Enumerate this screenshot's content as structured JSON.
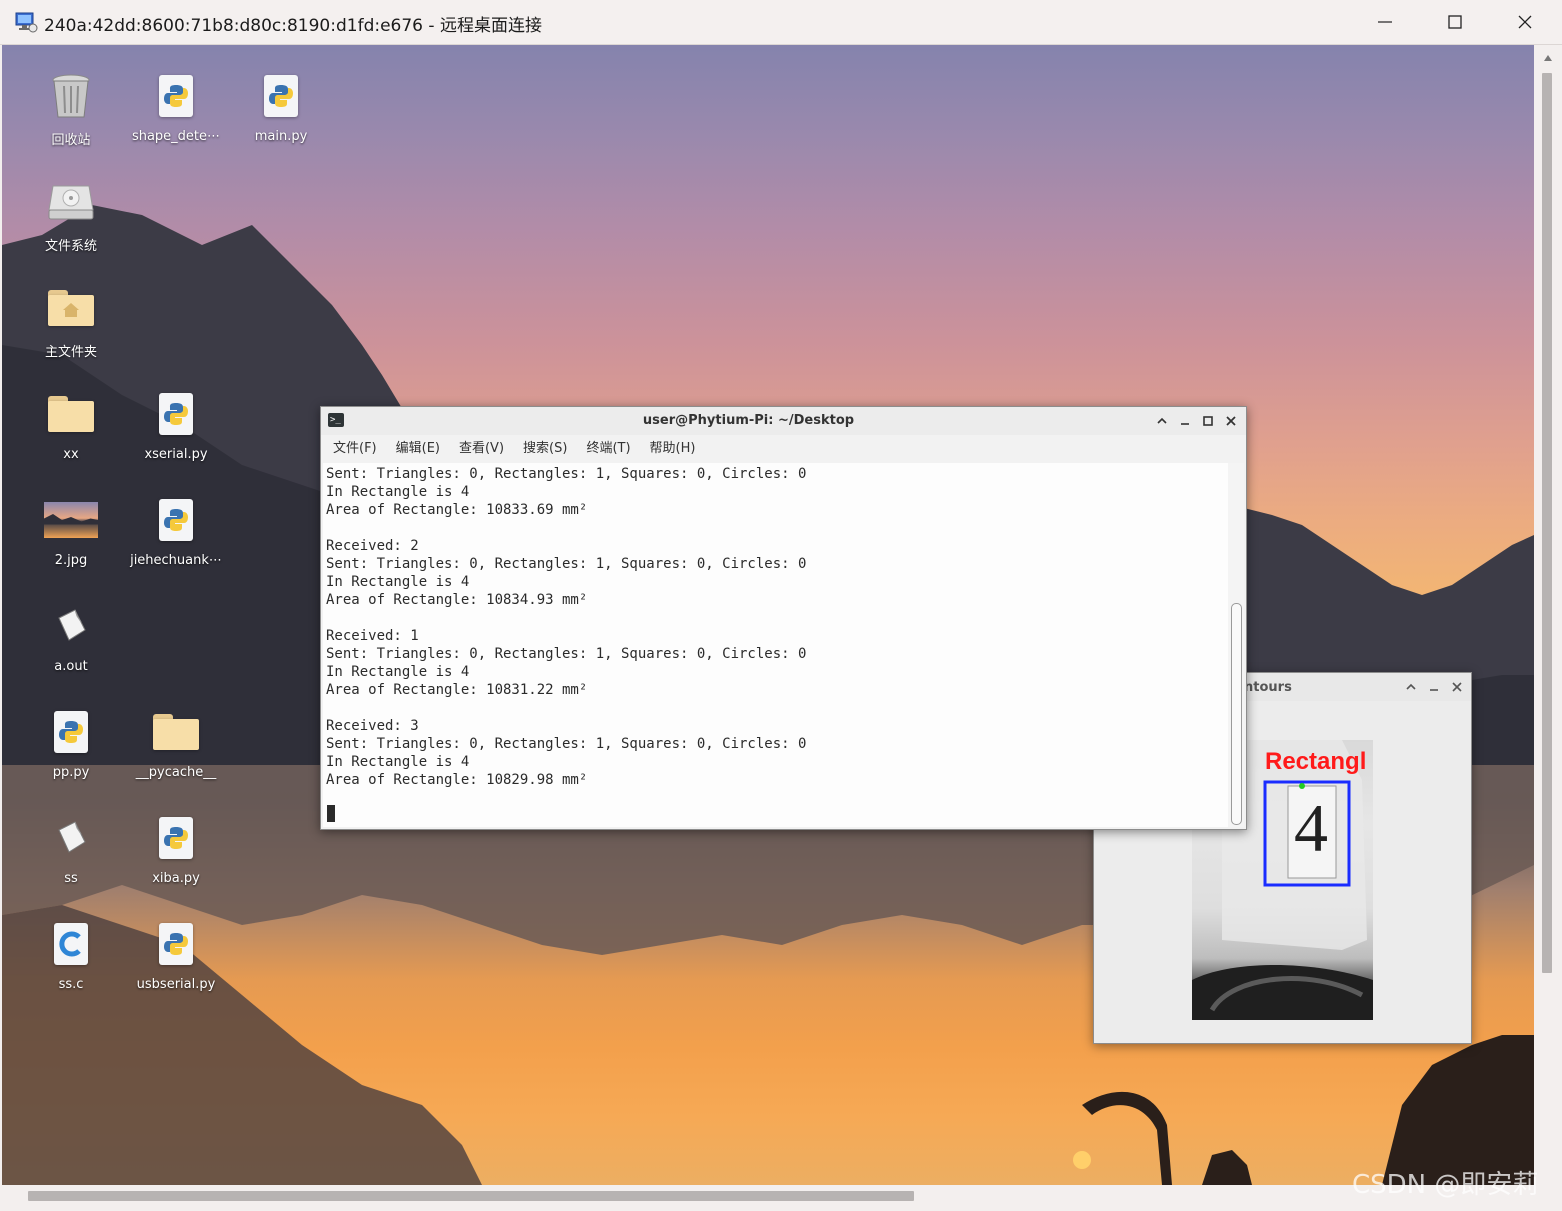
{
  "rdp": {
    "title": "240a:42dd:8600:71b8:d80c:8190:d1fd:e676 - 远程桌面连接"
  },
  "desktop_icons": [
    {
      "label": "回收站",
      "icon": "trash-icon"
    },
    {
      "label": "shape_dete⋯",
      "icon": "python-file-icon"
    },
    {
      "label": "main.py",
      "icon": "python-file-icon"
    },
    {
      "label": "文件系统",
      "icon": "drive-icon"
    },
    {
      "label": "主文件夹",
      "icon": "home-folder-icon"
    },
    {
      "label": "xx",
      "icon": "folder-icon"
    },
    {
      "label": "xserial.py",
      "icon": "python-file-icon"
    },
    {
      "label": "2.jpg",
      "icon": "image-thumbnail-icon"
    },
    {
      "label": "jiehechuank⋯",
      "icon": "python-file-icon"
    },
    {
      "label": "a.out",
      "icon": "binary-file-icon"
    },
    {
      "label": "pp.py",
      "icon": "python-file-icon"
    },
    {
      "label": "__pycache__",
      "icon": "folder-icon"
    },
    {
      "label": "ss",
      "icon": "binary-file-icon"
    },
    {
      "label": "xiba.py",
      "icon": "python-file-icon"
    },
    {
      "label": "ss.c",
      "icon": "c-file-icon"
    },
    {
      "label": "usbserial.py",
      "icon": "python-file-icon"
    }
  ],
  "terminal": {
    "title": "user@Phytium-Pi: ~/Desktop",
    "menu": [
      "文件(F)",
      "编辑(E)",
      "查看(V)",
      "搜索(S)",
      "终端(T)",
      "帮助(H)"
    ],
    "lines": [
      "Sent: Triangles: 0, Rectangles: 1, Squares: 0, Circles: 0",
      "In Rectangle is 4",
      "Area of Rectangle: 10833.69 mm²",
      "",
      "Received: 2",
      "Sent: Triangles: 0, Rectangles: 1, Squares: 0, Circles: 0",
      "In Rectangle is 4",
      "Area of Rectangle: 10834.93 mm²",
      "",
      "Received: 1",
      "Sent: Triangles: 0, Rectangles: 1, Squares: 0, Circles: 0",
      "In Rectangle is 4",
      "Area of Rectangle: 10831.22 mm²",
      "",
      "Received: 3",
      "Sent: Triangles: 0, Rectangles: 1, Squares: 0, Circles: 0",
      "In Rectangle is 4",
      "Area of Rectangle: 10829.98 mm²"
    ]
  },
  "contours_window": {
    "title": "ntours",
    "overlay_label": "Rectangl",
    "detected_digit": "4"
  },
  "watermark": "CSDN @即安莉",
  "colors": {
    "overlay_label": "#ff1a1a",
    "bounding_box": "#1a2cff",
    "center_point": "#22cc22"
  }
}
